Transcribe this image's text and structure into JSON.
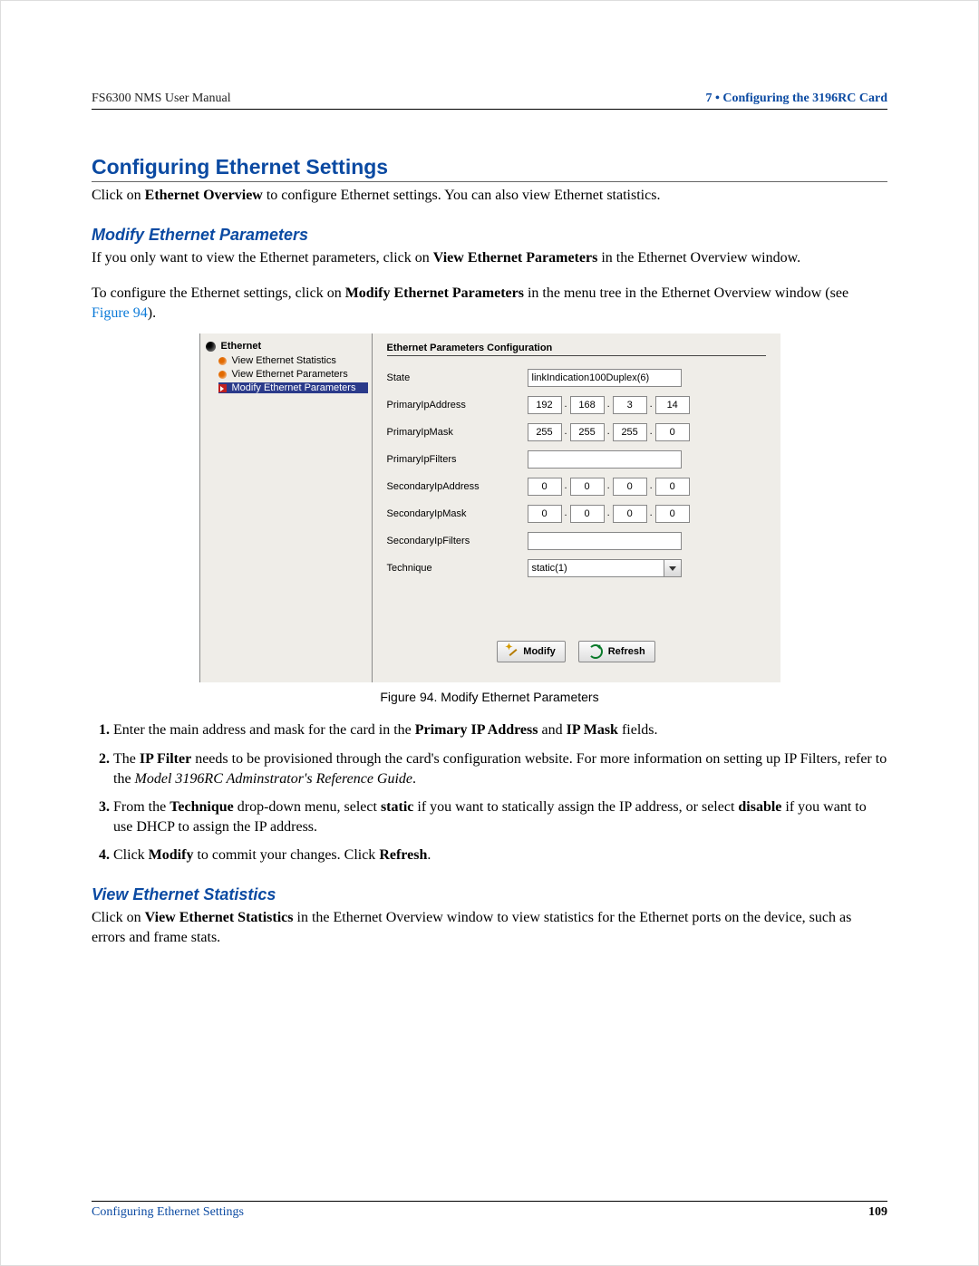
{
  "header": {
    "left": "FS6300 NMS User Manual",
    "right": "7 • Configuring the 3196RC Card"
  },
  "section": {
    "title": "Configuring Ethernet Settings",
    "intro_pre": "Click on ",
    "intro_b1": "Ethernet Overview",
    "intro_post": " to configure Ethernet settings. You can also view Ethernet statistics."
  },
  "sub1": {
    "title": "Modify Ethernet Parameters",
    "p1_a": "If you only want to view the Ethernet parameters, click on ",
    "p1_b": "View Ethernet Parameters",
    "p1_c": " in the Ethernet Overview window.",
    "p2_a": "To configure the Ethernet settings, click on ",
    "p2_b": "Modify Ethernet Parameters",
    "p2_c": " in the menu tree in the Ethernet Overview window (see ",
    "p2_link": "Figure 94",
    "p2_d": ")."
  },
  "ui": {
    "tree_root": "Ethernet",
    "tree_items": [
      "View Ethernet Statistics",
      "View Ethernet Parameters",
      "Modify Ethernet Parameters"
    ],
    "panel_title": "Ethernet Parameters Configuration",
    "rows": {
      "state_label": "State",
      "state_value": "linkIndication100Duplex(6)",
      "pip_label": "PrimaryIpAddress",
      "pip": [
        "192",
        "168",
        "3",
        "14"
      ],
      "pmask_label": "PrimaryIpMask",
      "pmask": [
        "255",
        "255",
        "255",
        "0"
      ],
      "pfilt_label": "PrimaryIpFilters",
      "sip_label": "SecondaryIpAddress",
      "sip": [
        "0",
        "0",
        "0",
        "0"
      ],
      "smask_label": "SecondaryIpMask",
      "smask": [
        "0",
        "0",
        "0",
        "0"
      ],
      "sfilt_label": "SecondaryIpFilters",
      "tech_label": "Technique",
      "tech_value": "static(1)"
    },
    "buttons": {
      "modify": "Modify",
      "refresh": "Refresh"
    }
  },
  "caption": "Figure 94. Modify Ethernet Parameters",
  "steps": {
    "s1_a": "Enter the main address and mask for the card in the ",
    "s1_b1": "Primary IP Address",
    "s1_mid": " and ",
    "s1_b2": "IP Mask",
    "s1_c": " fields.",
    "s2_a": "The ",
    "s2_b": "IP Filter",
    "s2_c": " needs to be provisioned through the card's configuration website. For more information on setting up IP Filters, refer to the ",
    "s2_i": "Model 3196RC Adminstrator's Reference Guide",
    "s2_d": ".",
    "s3_a": "From the ",
    "s3_b1": "Technique",
    "s3_mid1": " drop-down menu, select ",
    "s3_b2": "static",
    "s3_mid2": " if you want to statically assign the IP address, or select ",
    "s3_b3": "disable",
    "s3_c": " if you want to use DHCP to assign the IP address.",
    "s4_a": "Click ",
    "s4_b1": "Modify",
    "s4_mid": " to commit your changes. Click ",
    "s4_b2": "Refresh",
    "s4_c": "."
  },
  "sub2": {
    "title": "View Ethernet Statistics",
    "p_a": "Click on ",
    "p_b": "View Ethernet Statistics",
    "p_c": " in the Ethernet Overview window to view statistics for the Ethernet ports on the device, such as errors and frame stats."
  },
  "footer": {
    "left": "Configuring Ethernet Settings",
    "right": "109"
  }
}
